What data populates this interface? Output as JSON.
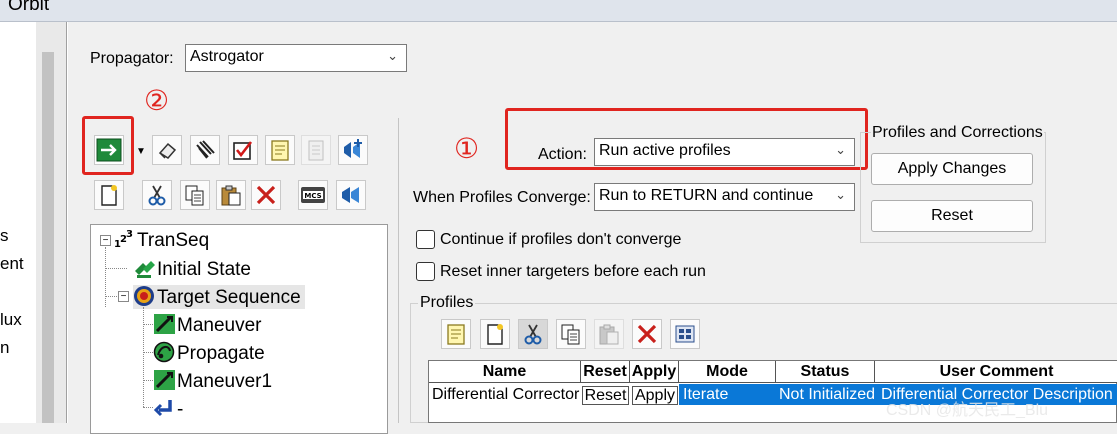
{
  "window": {
    "title": "Orbit"
  },
  "left_panel_fragments": [
    "s",
    "ent",
    "lux",
    "n"
  ],
  "propagator": {
    "label": "Propagator:",
    "value": "Astrogator"
  },
  "annotations": {
    "marker_1": "①",
    "marker_2": "②"
  },
  "toolbar_icons_row1": [
    "run-arrow-icon",
    "dropdown-arrow-icon",
    "clear-icon",
    "notebook-icon",
    "checklist-icon",
    "note-icon",
    "disabled-note-icon",
    "insert-segment-icon"
  ],
  "toolbar_icons_row2": [
    "new-icon",
    "cut-icon",
    "copy-icon",
    "paste-icon",
    "delete-icon",
    "mcs-icon",
    "sequence-icon"
  ],
  "tree": {
    "items": [
      {
        "label": "TranSeq",
        "icon": "sequence-numbers-icon"
      },
      {
        "label": "Initial State",
        "icon": "initial-state-icon"
      },
      {
        "label": "Target Sequence",
        "icon": "target-icon"
      },
      {
        "label": "Maneuver",
        "icon": "maneuver-icon"
      },
      {
        "label": "Propagate",
        "icon": "propagate-icon"
      },
      {
        "label": "Maneuver1",
        "icon": "maneuver-icon"
      },
      {
        "label": "-",
        "icon": "return-icon"
      }
    ]
  },
  "action": {
    "label": "Action:",
    "value": "Run active profiles"
  },
  "converge": {
    "label": "When Profiles Converge:",
    "value": "Run to RETURN and continue"
  },
  "profiles_corrections": {
    "title": "Profiles and Corrections",
    "apply_label": "Apply Changes",
    "reset_label": "Reset"
  },
  "checkboxes": {
    "continue_label": "Continue if profiles don't converge",
    "reset_inner_label": "Reset inner targeters before each run"
  },
  "profiles": {
    "title": "Profiles",
    "toolbar_icons": [
      "note-icon",
      "new-icon",
      "cut-icon",
      "copy-icon",
      "paste-icon",
      "delete-icon",
      "properties-icon"
    ],
    "columns": [
      "Name",
      "Reset",
      "Apply",
      "Mode",
      "Status",
      "User Comment"
    ],
    "rows": [
      {
        "name": "Differential Corrector",
        "reset": "Reset",
        "apply": "Apply",
        "mode": "Iterate",
        "status": "Not Initialized",
        "comment": "Differential Corrector Description"
      }
    ]
  },
  "watermark": "CSDN @航天民工_Blu",
  "colors": {
    "highlight_red": "#e0251f",
    "selection_blue": "#0a78d7"
  }
}
